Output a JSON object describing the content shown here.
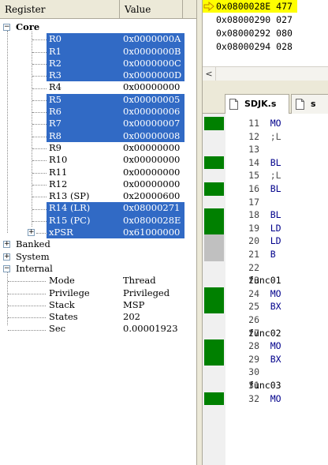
{
  "registers": {
    "header": {
      "name": "Register",
      "value": "Value"
    },
    "groups": {
      "core": "Core",
      "banked": "Banked",
      "system": "System",
      "internal": "Internal"
    },
    "core": [
      {
        "name": "R0",
        "value": "0x0000000A",
        "selected": true
      },
      {
        "name": "R1",
        "value": "0x0000000B",
        "selected": true
      },
      {
        "name": "R2",
        "value": "0x0000000C",
        "selected": true
      },
      {
        "name": "R3",
        "value": "0x0000000D",
        "selected": true
      },
      {
        "name": "R4",
        "value": "0x00000000",
        "selected": false
      },
      {
        "name": "R5",
        "value": "0x00000005",
        "selected": true
      },
      {
        "name": "R6",
        "value": "0x00000006",
        "selected": true
      },
      {
        "name": "R7",
        "value": "0x00000007",
        "selected": true
      },
      {
        "name": "R8",
        "value": "0x00000008",
        "selected": true
      },
      {
        "name": "R9",
        "value": "0x00000000",
        "selected": false
      },
      {
        "name": "R10",
        "value": "0x00000000",
        "selected": false
      },
      {
        "name": "R11",
        "value": "0x00000000",
        "selected": false
      },
      {
        "name": "R12",
        "value": "0x00000000",
        "selected": false
      },
      {
        "name": "R13 (SP)",
        "value": "0x20000600",
        "selected": false
      },
      {
        "name": "R14 (LR)",
        "value": "0x08000271",
        "selected": true
      },
      {
        "name": "R15 (PC)",
        "value": "0x0800028E",
        "selected": true
      },
      {
        "name": "xPSR",
        "value": "0x61000000",
        "selected": true
      }
    ],
    "internal": [
      {
        "name": "Mode",
        "value": "Thread"
      },
      {
        "name": "Privilege",
        "value": "Privileged"
      },
      {
        "name": "Stack",
        "value": "MSP"
      },
      {
        "name": "States",
        "value": "202"
      },
      {
        "name": "Sec",
        "value": "0.00001923"
      }
    ]
  },
  "disassembly": {
    "lines": [
      {
        "text": "0x0800028E 477",
        "current": true
      },
      {
        "text": "0x08000290 027",
        "current": false
      },
      {
        "text": "0x08000292 080",
        "current": false
      },
      {
        "text": "0x08000294 028",
        "current": false
      }
    ],
    "scroll_left": "<"
  },
  "tabs": [
    {
      "label": "SDJK.s",
      "active": true
    },
    {
      "label": "s",
      "active": false
    }
  ],
  "editor": {
    "lines": [
      {
        "num": "11",
        "text": "    MO",
        "kind": "code",
        "mark": "green"
      },
      {
        "num": "12",
        "text": "    ;L",
        "kind": "cmt",
        "mark": "none"
      },
      {
        "num": "13",
        "text": "",
        "kind": "code",
        "mark": "none"
      },
      {
        "num": "14",
        "text": "    BL",
        "kind": "code",
        "mark": "green"
      },
      {
        "num": "15",
        "text": "    ;L",
        "kind": "cmt",
        "mark": "none"
      },
      {
        "num": "16",
        "text": "    BL",
        "kind": "code",
        "mark": "green"
      },
      {
        "num": "17",
        "text": "",
        "kind": "code",
        "mark": "none"
      },
      {
        "num": "18",
        "text": "    BL",
        "kind": "code",
        "mark": "green"
      },
      {
        "num": "19",
        "text": "    LD",
        "kind": "code",
        "mark": "green"
      },
      {
        "num": "20",
        "text": "    LD",
        "kind": "code",
        "mark": "gray"
      },
      {
        "num": "21",
        "text": "    B",
        "kind": "code",
        "mark": "gray"
      },
      {
        "num": "22",
        "text": "",
        "kind": "code",
        "mark": "none"
      },
      {
        "num": "23",
        "text": "func01",
        "kind": "lbl",
        "mark": "none"
      },
      {
        "num": "24",
        "text": "    MO",
        "kind": "code",
        "mark": "green"
      },
      {
        "num": "25",
        "text": "    BX",
        "kind": "code",
        "mark": "green"
      },
      {
        "num": "26",
        "text": "",
        "kind": "code",
        "mark": "none"
      },
      {
        "num": "27",
        "text": "func02",
        "kind": "lbl",
        "mark": "none"
      },
      {
        "num": "28",
        "text": "    MO",
        "kind": "code",
        "mark": "green"
      },
      {
        "num": "29",
        "text": "    BX",
        "kind": "code",
        "mark": "green"
      },
      {
        "num": "30",
        "text": "",
        "kind": "code",
        "mark": "none"
      },
      {
        "num": "31",
        "text": "func03",
        "kind": "lbl",
        "mark": "none"
      },
      {
        "num": "32",
        "text": "    MO",
        "kind": "code",
        "mark": "green"
      }
    ]
  },
  "colors": {
    "selection": "#316ac5",
    "current_line": "#ffff00",
    "exec_mark": "#008000",
    "partial_mark": "#c0c0c0"
  }
}
